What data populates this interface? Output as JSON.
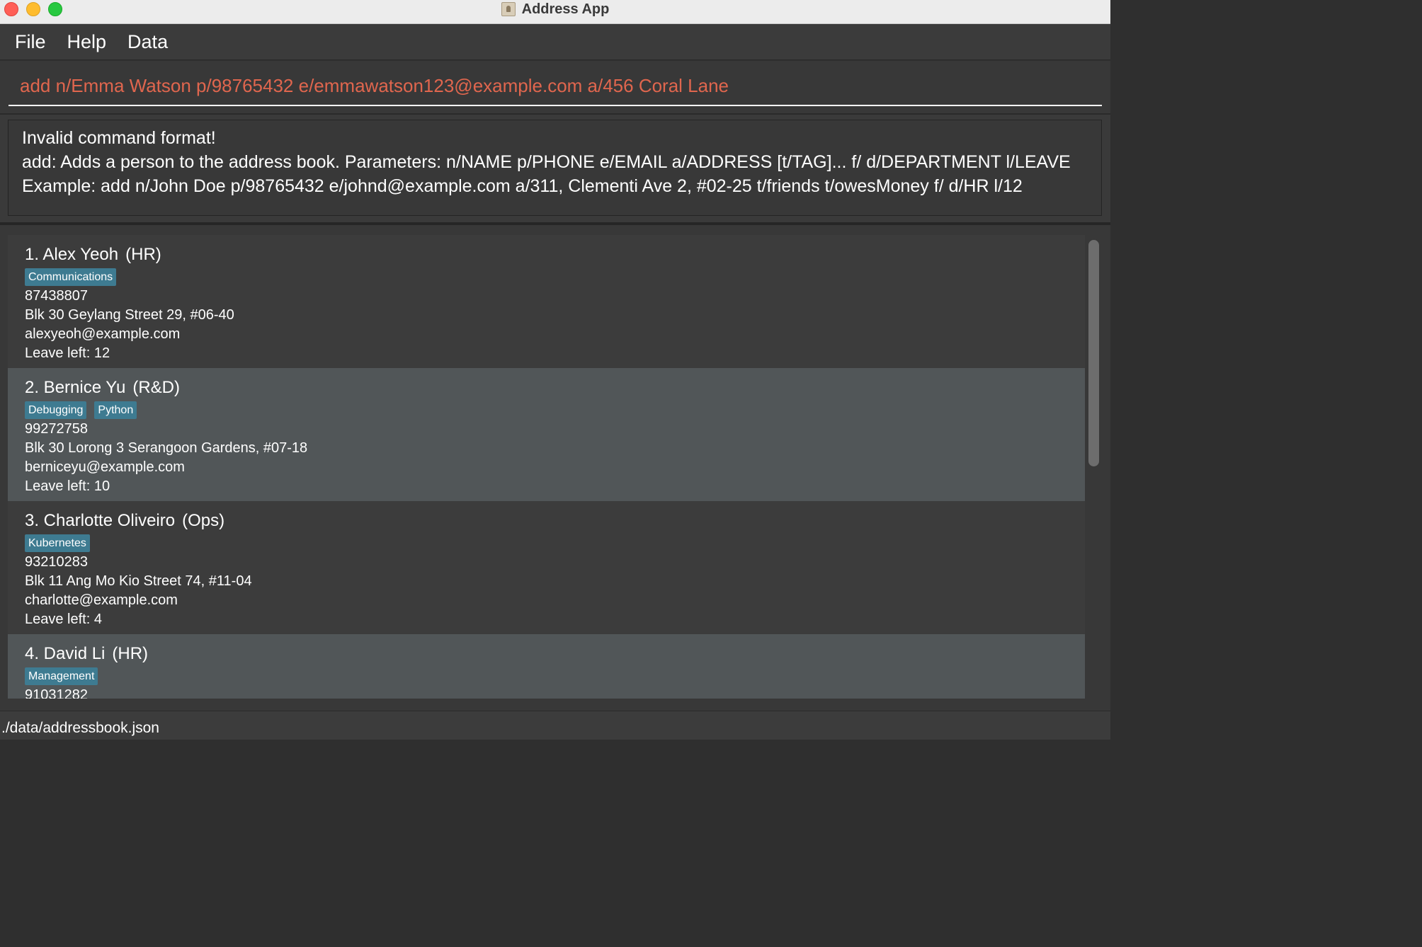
{
  "window": {
    "title": "Address App"
  },
  "menu": {
    "items": [
      "File",
      "Help",
      "Data"
    ]
  },
  "command": {
    "value": "add n/Emma Watson p/98765432 e/emmawatson123@example.com a/456 Coral Lane"
  },
  "result": {
    "lines": [
      "Invalid command format!",
      "add: Adds a person to the address book. Parameters: n/NAME p/PHONE e/EMAIL a/ADDRESS [t/TAG]... f/ d/DEPARTMENT l/LEAVE",
      "Example: add n/John Doe p/98765432 e/johnd@example.com a/311, Clementi Ave 2, #02-25 t/friends t/owesMoney f/ d/HR l/12"
    ]
  },
  "persons": [
    {
      "name": "1. Alex Yeoh",
      "department": "(HR)",
      "tags": [
        "Communications"
      ],
      "phone": "87438807",
      "address": "Blk 30 Geylang Street 29, #06-40",
      "email": "alexyeoh@example.com",
      "leave": "Leave left: 12"
    },
    {
      "name": "2. Bernice Yu",
      "department": "(R&D)",
      "tags": [
        "Debugging",
        "Python"
      ],
      "phone": "99272758",
      "address": "Blk 30 Lorong 3 Serangoon Gardens, #07-18",
      "email": "berniceyu@example.com",
      "leave": "Leave left: 10"
    },
    {
      "name": "3. Charlotte Oliveiro",
      "department": "(Ops)",
      "tags": [
        "Kubernetes"
      ],
      "phone": "93210283",
      "address": "Blk 11 Ang Mo Kio Street 74, #11-04",
      "email": "charlotte@example.com",
      "leave": "Leave left: 4"
    },
    {
      "name": "4. David Li",
      "department": "(HR)",
      "tags": [
        "Management"
      ],
      "phone": "91031282",
      "address": "",
      "email": "",
      "leave": ""
    }
  ],
  "status": {
    "path": "./data/addressbook.json"
  },
  "colors": {
    "command_text": "#e0664e",
    "tag_bg": "#3e7b91",
    "card_alt_bg": "#515658",
    "card_bg": "#3c3c3c"
  }
}
